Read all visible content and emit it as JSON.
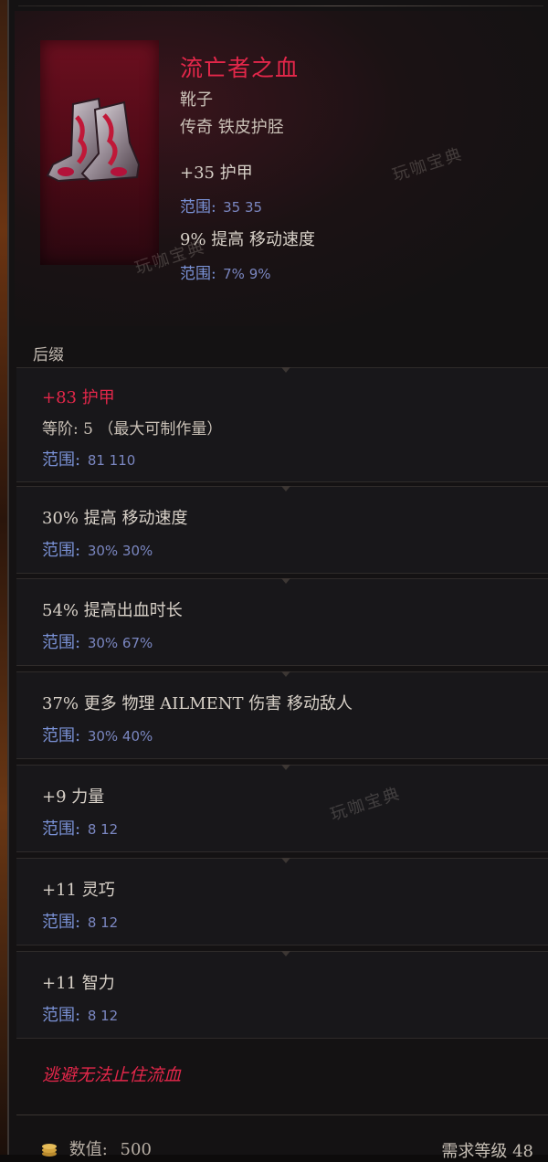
{
  "item": {
    "name": "流亡者之血",
    "type": "靴子",
    "rarity_line": "传奇 铁皮护胫",
    "icon": "red-boots-icon"
  },
  "implicits": [
    {
      "value": "+35 护甲",
      "range_label": "范围:",
      "range": "35  35"
    },
    {
      "value": "9% 提高 移动速度",
      "range_label": "范围:",
      "range": "7%  9%"
    }
  ],
  "section_label": "后缀",
  "affixes": [
    {
      "value": "+83 护甲",
      "tier": "等阶: 5 （最大可制作量）",
      "range_label": "范围:",
      "range": "81  110"
    },
    {
      "value": "30% 提高 移动速度",
      "range_label": "范围:",
      "range": "30%  30%"
    },
    {
      "value": "54% 提高出血时长",
      "range_label": "范围:",
      "range": "30%  67%"
    },
    {
      "value": "37% 更多 物理 AILMENT 伤害 移动敌人",
      "range_label": "范围:",
      "range": "30%  40%"
    },
    {
      "value": "+9 力量",
      "range_label": "范围:",
      "range": "8  12"
    },
    {
      "value": "+11 灵巧",
      "range_label": "范围:",
      "range": "8  12"
    },
    {
      "value": "+11 智力",
      "range_label": "范围:",
      "range": "8  12"
    }
  ],
  "unique_text": "逃避无法止住流血",
  "footer": {
    "value_label": "数值:",
    "value": "500",
    "level_text": "需求等级 48",
    "coin_icon": "coin-stack-icon"
  },
  "watermarks": [
    "玩咖宝典",
    "玩咖宝典",
    "玩咖宝典"
  ],
  "colors": {
    "unique_red": "#e3274a",
    "range_blue": "#7a92d6",
    "text": "#d8d1c8",
    "panel": "#18171a"
  }
}
